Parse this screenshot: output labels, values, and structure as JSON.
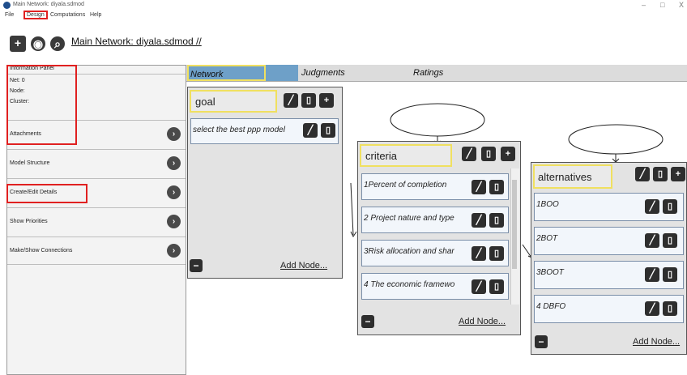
{
  "window": {
    "title": "Main Network: diyala.sdmod",
    "minimize": "–",
    "maximize": "□",
    "close": "X"
  },
  "menu": {
    "file": "File",
    "design": "Design",
    "computations": "Computations",
    "help": "Help"
  },
  "toolbar": {
    "add": "+",
    "view": "◉",
    "zoom": "⌕",
    "main_title": "Main Network: diyala.sdmod //"
  },
  "left_panel": {
    "info_header": "Information Panel",
    "net": "Net: 0",
    "node": "Node:",
    "cluster": "Cluster:",
    "rows": [
      {
        "label": "Attachments"
      },
      {
        "label": "Model Structure"
      },
      {
        "label": "Create/Edit Details"
      },
      {
        "label": "Show Priorities"
      },
      {
        "label": "Make/Show Connections"
      }
    ],
    "arrow": "›"
  },
  "tabs": {
    "network": "Network",
    "judgments": "Judgments",
    "ratings": "Ratings"
  },
  "clusters": {
    "goal": {
      "title": "goal",
      "nodes": [
        "select the best ppp model"
      ],
      "add_node": "Add Node..."
    },
    "criteria": {
      "title": "criteria",
      "nodes": [
        "1Percent of completion",
        "2 Project nature and type",
        "3Risk allocation and shar",
        "4 The economic framewo"
      ],
      "add_node": "Add Node..."
    },
    "alternatives": {
      "title": "alternatives",
      "nodes": [
        "1BOO",
        "2BOT",
        "3BOOT",
        "4 DBFO"
      ],
      "add_node": "Add Node..."
    }
  },
  "icons": {
    "edit": "╱",
    "delete": "▯",
    "add": "+",
    "collapse": "−"
  },
  "colors": {
    "tab_active": "#6ea0c8",
    "highlight_red": "#e02020",
    "highlight_yellow": "#f0e060"
  }
}
